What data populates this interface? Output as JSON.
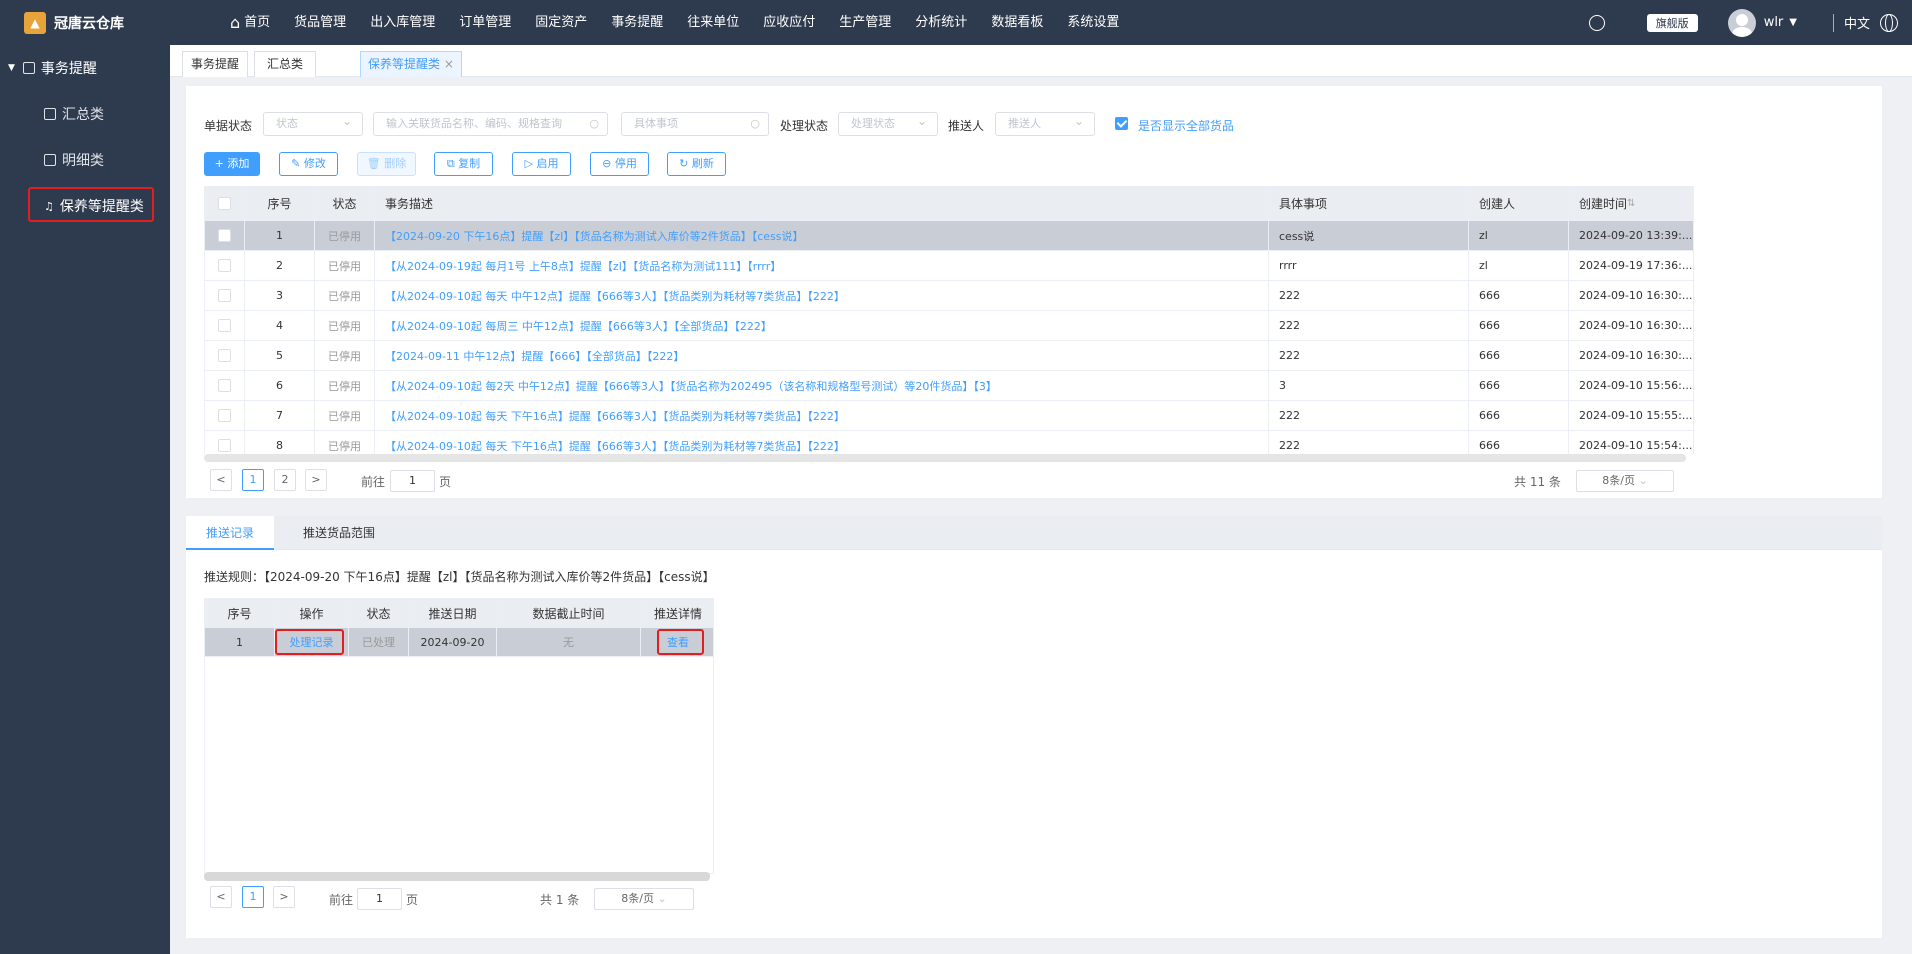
{
  "app": {
    "name": "冠唐云仓库",
    "logo_char": "▲"
  },
  "nav": [
    "首页",
    "货品管理",
    "出入库管理",
    "订单管理",
    "固定资产",
    "事务提醒",
    "往来单位",
    "应收应付",
    "生产管理",
    "分析统计",
    "数据看板",
    "系统设置"
  ],
  "header": {
    "edition": "旗舰版",
    "user": "wlr",
    "lang": "中文"
  },
  "sidebar": {
    "group": "事务提醒",
    "items": [
      {
        "label": "汇总类"
      },
      {
        "label": "明细类"
      },
      {
        "label": "保养等提醒类"
      }
    ]
  },
  "tabs": [
    {
      "label": "事务提醒"
    },
    {
      "label": "汇总类"
    },
    {
      "label": "保养等提醒类"
    }
  ],
  "filters": {
    "doc_status_label": "单据状态",
    "doc_status_placeholder": "状态",
    "search_placeholder": "输入关联货品名称、编码、规格查询",
    "item_placeholder": "具体事项",
    "proc_status_label": "处理状态",
    "proc_status_placeholder": "处理状态",
    "pusher_label": "推送人",
    "pusher_placeholder": "推送人",
    "show_all_label": "是否显示全部货品"
  },
  "toolbar": {
    "add": "+ 添加",
    "edit": "✎ 修改",
    "delete": "🗑 删除",
    "copy": "⧉ 复制",
    "enable": "▷ 启用",
    "disable": "⊖ 停用",
    "refresh": "↻ 刷新"
  },
  "table": {
    "columns": [
      "序号",
      "状态",
      "事务描述",
      "具体事项",
      "创建人",
      "创建时间"
    ],
    "sort_icon": "⇅",
    "rows": [
      {
        "no": "1",
        "status": "已停用",
        "desc": "【2024-09-20 下午16点】提醒【zl】【货品名称为测试入库价等2件货品】【cess说】",
        "item": "cess说",
        "creator": "zl",
        "time": "2024-09-20 13:39:..."
      },
      {
        "no": "2",
        "status": "已停用",
        "desc": "【从2024-09-19起 每月1号 上午8点】提醒【zl】【货品名称为测试111】【rrrr】",
        "item": "rrrr",
        "creator": "zl",
        "time": "2024-09-19 17:36:..."
      },
      {
        "no": "3",
        "status": "已停用",
        "desc": "【从2024-09-10起 每天 中午12点】提醒【666等3人】【货品类别为耗材等7类货品】【222】",
        "item": "222",
        "creator": "666",
        "time": "2024-09-10 16:30:..."
      },
      {
        "no": "4",
        "status": "已停用",
        "desc": "【从2024-09-10起 每周三 中午12点】提醒【666等3人】【全部货品】【222】",
        "item": "222",
        "creator": "666",
        "time": "2024-09-10 16:30:..."
      },
      {
        "no": "5",
        "status": "已停用",
        "desc": "【2024-09-11 中午12点】提醒【666】【全部货品】【222】",
        "item": "222",
        "creator": "666",
        "time": "2024-09-10 16:30:..."
      },
      {
        "no": "6",
        "status": "已停用",
        "desc": "【从2024-09-10起 每2天 中午12点】提醒【666等3人】【货品名称为202495（该名称和规格型号测试）等20件货品】【3】",
        "item": "3",
        "creator": "666",
        "time": "2024-09-10 15:56:..."
      },
      {
        "no": "7",
        "status": "已停用",
        "desc": "【从2024-09-10起 每天 下午16点】提醒【666等3人】【货品类别为耗材等7类货品】【222】",
        "item": "222",
        "creator": "666",
        "time": "2024-09-10 15:55:..."
      },
      {
        "no": "8",
        "status": "已停用",
        "desc": "【从2024-09-10起 每天 下午16点】提醒【666等3人】【货品类别为耗材等7类货品】【222】",
        "item": "222",
        "creator": "666",
        "time": "2024-09-10 15:54:..."
      }
    ]
  },
  "pager1": {
    "prev": "<",
    "next": ">",
    "pages": [
      "1",
      "2"
    ],
    "goto": "前往",
    "goto_value": "1",
    "page_unit": "页",
    "total": "共 11 条",
    "size": "8条/页"
  },
  "subtabs": [
    "推送记录",
    "推送货品范围"
  ],
  "push_rule": "推送规则：【2024-09-20 下午16点】提醒【zl】【货品名称为测试入库价等2件货品】【cess说】",
  "table2": {
    "columns": [
      "序号",
      "操作",
      "状态",
      "推送日期",
      "数据截止时间",
      "推送详情"
    ],
    "rows": [
      {
        "no": "1",
        "op": "处理记录",
        "status": "已处理",
        "date": "2024-09-20",
        "cutoff": "无",
        "detail": "查看"
      }
    ]
  },
  "pager2": {
    "prev": "<",
    "next": ">",
    "pages": [
      "1"
    ],
    "goto": "前往",
    "goto_value": "1",
    "page_unit": "页",
    "total": "共 1 条",
    "size": "8条/页"
  },
  "icons": {
    "home": "⌂",
    "sidebar_doc": "▤",
    "bell": "🔔"
  }
}
